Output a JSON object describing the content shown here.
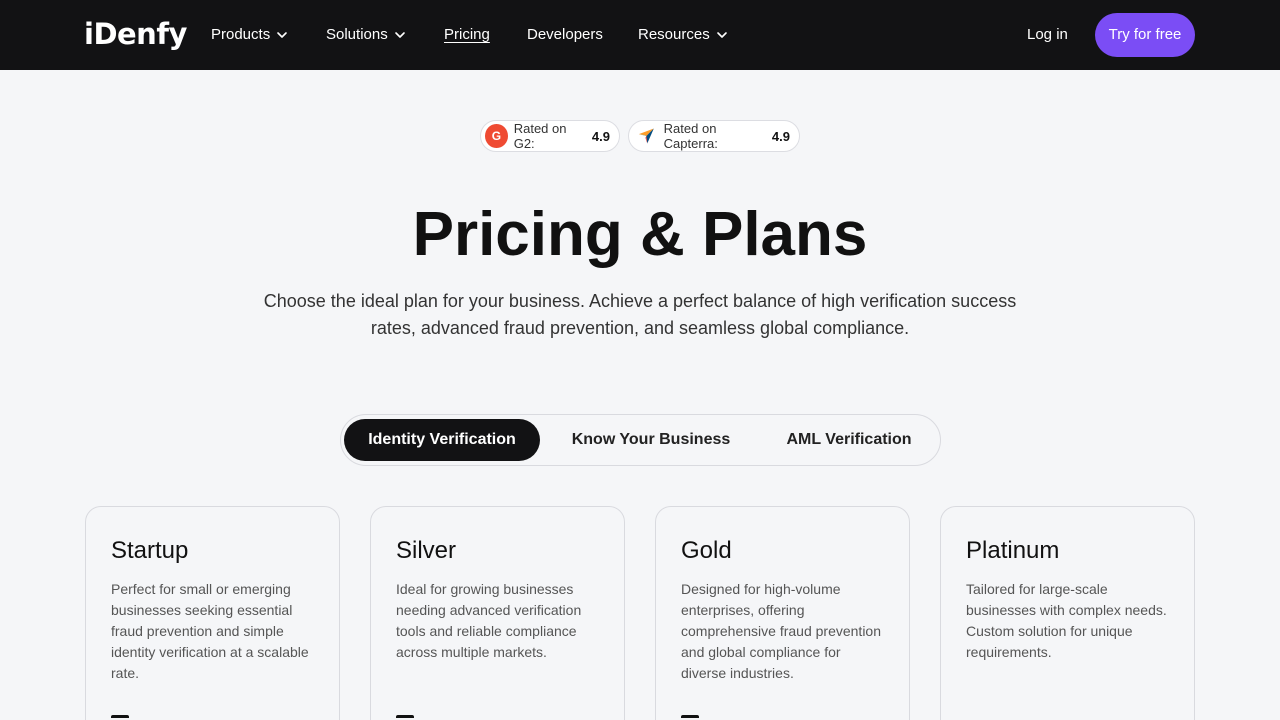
{
  "nav": {
    "logo": "iDenfy",
    "items": [
      {
        "label": "Products"
      },
      {
        "label": "Solutions"
      },
      {
        "label": "Pricing"
      },
      {
        "label": "Developers"
      },
      {
        "label": "Resources"
      }
    ],
    "login": "Log in",
    "cta": "Try for free"
  },
  "ratings": [
    {
      "label": "Rated on G2:",
      "score": "4.9",
      "icon": "g2-icon"
    },
    {
      "label": "Rated on Capterra:",
      "score": "4.9",
      "icon": "capterra-icon"
    }
  ],
  "hero": {
    "title": "Pricing & Plans",
    "subtitle": "Choose the ideal plan for your business. Achieve a perfect balance of high verification success rates, advanced fraud prevention, and seamless global compliance."
  },
  "tabs": [
    {
      "label": "Identity Verification",
      "active": true
    },
    {
      "label": "Know Your Business",
      "active": false
    },
    {
      "label": "AML Verification",
      "active": false
    }
  ],
  "plans": [
    {
      "name": "Startup",
      "description": "Perfect for small or emerging businesses seeking essential fraud prevention and simple identity verification at a scalable rate."
    },
    {
      "name": "Silver",
      "description": "Ideal for growing businesses needing advanced verification tools and reliable compliance across multiple markets."
    },
    {
      "name": "Gold",
      "description": "Designed for high-volume enterprises, offering comprehensive fraud prevention and global compliance for diverse industries."
    },
    {
      "name": "Platinum",
      "description": "Tailored for large-scale businesses with complex needs. Custom solution for unique requirements."
    }
  ],
  "colors": {
    "nav_bg": "#121214",
    "accent": "#7b4df5",
    "g2": "#ef4b33",
    "page_bg": "#f5f6f8"
  }
}
